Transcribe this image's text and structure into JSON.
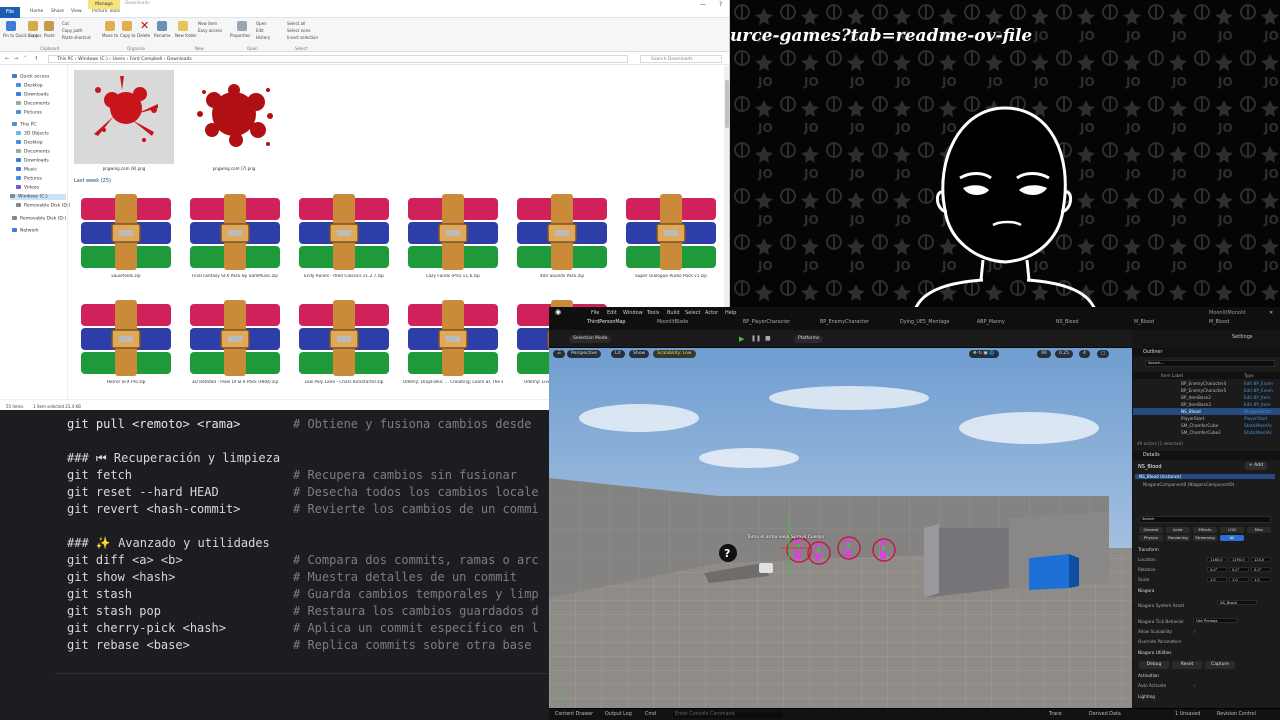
{
  "overlay": {
    "url_fragment": "urce-games?tab=readme-ov-file"
  },
  "explorer": {
    "tabs": [
      "File",
      "Home",
      "Share",
      "View",
      "Picture Tools"
    ],
    "manage_label": "Manage",
    "window_title": "Downloads",
    "ribbon": {
      "pin_label": "Pin to Quick access",
      "copy_label": "Copy",
      "paste_label": "Paste",
      "cut_label": "Cut",
      "copy_path_label": "Copy path",
      "paste_shortcut_label": "Paste shortcut",
      "move_to_label": "Move to",
      "copy_to_label": "Copy to",
      "delete_label": "Delete",
      "rename_label": "Rename",
      "new_folder_label": "New folder",
      "new_item_label": "New item",
      "easy_access_label": "Easy access",
      "properties_label": "Properties",
      "open_label": "Open",
      "edit_label": "Edit",
      "history_label": "History",
      "select_all_label": "Select all",
      "select_none_label": "Select none",
      "invert_selection_label": "Invert selection",
      "groups": [
        "Clipboard",
        "Organize",
        "New",
        "Open",
        "Select"
      ]
    },
    "address": [
      "This PC",
      "Windows (C:)",
      "Users",
      "Ford Campbell",
      "Downloads"
    ],
    "search_placeholder": "Search Downloads",
    "nav": [
      "Quick access",
      "Desktop",
      "Downloads",
      "Documents",
      "Pictures",
      "This PC",
      "3D Objects",
      "Desktop",
      "Documents",
      "Downloads",
      "Music",
      "Pictures",
      "Videos",
      "Windows (C:)",
      "Removable Disk (D:)",
      "Removable Disk (D:)",
      "Network"
    ],
    "images": [
      "pngwing.com (8).png",
      "pngwing.com (7).png"
    ],
    "group_label": "Last week (25)",
    "files_row1": [
      "Louiefolds.zip",
      "Final Fantasy SFX Pack By SamMusic.zip",
      "Ecdy Runes - Ifred Classics v1.2.7.zip",
      "Lazy Funds (Pro) v1.6.zip",
      "400 Sounds Pack.zip",
      "Super Dialogue Audio Pack v1.zip"
    ],
    "files_row2": [
      "Horror SFX Pro.zip",
      "3D Rotated - Pixel UI SFX Pack (HRB).zip",
      "Low Poly Lane - Chars Kickstarter.zip",
      "Udemy: DropFolks: ... Cheating; Learn as The Easiest_Way_2025...Downloadly.ir.rar",
      "Udemy: Live Tr..._Course_2025...zip",
      ""
    ],
    "status_items": "55 items",
    "status_selected": "1 item selected  25.4 KB"
  },
  "terminal": {
    "lines": [
      {
        "cmd": "git pull <remoto> <rama>",
        "comment": "# Obtiene y fusiona cambios desde"
      },
      {
        "head": "### ⏮ Recuperación y limpieza"
      },
      {
        "cmd": "git fetch",
        "comment": "# Recupera cambios sin fusionar"
      },
      {
        "cmd": "git reset --hard HEAD",
        "comment": "# Desecha todos los cambios locale"
      },
      {
        "cmd": "git revert <hash-commit>",
        "comment": "# Revierte los cambios de un commi"
      },
      {
        "head": "### ✨ Avanzado y utilidades"
      },
      {
        "cmd": "git diff <a> <b>",
        "comment": "# Compara dos commits, ramas o arc"
      },
      {
        "cmd": "git show <hash>",
        "comment": "# Muestra detalles de un commit"
      },
      {
        "cmd": "git stash",
        "comment": "# Guarda cambios temporales y limp"
      },
      {
        "cmd": "git stash pop",
        "comment": "# Restaura los cambios guardados d"
      },
      {
        "cmd": "git cherry-pick <hash>",
        "comment": "# Aplica un commit específico en l"
      },
      {
        "cmd": "git rebase <base>",
        "comment": "# Replica commits sobre otra base"
      }
    ]
  },
  "unreal": {
    "window_title": "MoonlitMonolit",
    "menu": [
      "File",
      "Edit",
      "Window",
      "Tools",
      "Build",
      "Select",
      "Actor",
      "Help"
    ],
    "tabs": [
      "ThirdPersonMap",
      "MoonlitBlade",
      "BP_PlayerCharacter",
      "BP_EnemyCharacter",
      "Dying_UE5_Montage",
      "ABP_Manny",
      "NS_Blood",
      "M_Blood",
      "M_Blood"
    ],
    "toolbar": {
      "mode": "Selection Mode",
      "platforms": "Platforms",
      "settings": "Settings"
    },
    "viewport": {
      "perspective": "Perspective",
      "lit": "Lit",
      "show": "Show",
      "scalability": "Scalability: Low",
      "fov": "90",
      "snap": "0.25",
      "cam": "4"
    },
    "outliner": {
      "title": "Outliner",
      "search_placeholder": "Search...",
      "col_label": "Item Label",
      "col_type": "Type",
      "rows": [
        {
          "name": "BP_EnemyCharacter4",
          "type": "Edit BP_Enem"
        },
        {
          "name": "BP_EnemyCharacter5",
          "type": "Edit BP_Enem"
        },
        {
          "name": "BP_ItemBase2",
          "type": "Edit BP_Item"
        },
        {
          "name": "BP_ItemBase3",
          "type": "Edit BP_Item"
        },
        {
          "name": "NS_Blood",
          "type": "NiagaraActor"
        },
        {
          "name": "PlayerStart",
          "type": "PlayerStart"
        },
        {
          "name": "SM_ChamferCube",
          "type": "StaticMeshAc"
        },
        {
          "name": "SM_ChamferCube2",
          "type": "StaticMeshAc"
        }
      ],
      "count": "49 actors (1 selected)"
    },
    "details": {
      "title": "Details",
      "actor": "NS_Blood",
      "add": "+ Add",
      "component_root": "NS_Blood (Instance)",
      "component_child": "NiagaraComponent0 (NiagaraComponent0)",
      "search_placeholder": "Search",
      "filters1": [
        "General",
        "Actor",
        "Effects",
        "LOD",
        "Misc"
      ],
      "filters2": [
        "Physics",
        "Rendering",
        "Streaming",
        "All"
      ],
      "transform_label": "Transform",
      "location_label": "Location",
      "rotation_label": "Rotation",
      "scale_label": "Scale",
      "location": [
        "1160.0",
        "1190.0",
        "120.0"
      ],
      "rotation": [
        "0.0°",
        "0.0°",
        "0.0°"
      ],
      "scale": [
        "1.0",
        "1.0",
        "1.0"
      ],
      "niagara_label": "Niagara",
      "system_asset_label": "Niagara System Asset",
      "system_asset_value": "NS_Blood",
      "tick_behavior_label": "Niagara Tick Behavior",
      "tick_behavior_value": "Use Prereqs",
      "allow_scalability_label": "Allow Scalability",
      "override_params_label": "Override Parameters",
      "utilities_label": "Niagara Utilities",
      "debug": "Debug",
      "reset": "Reset",
      "capture": "Capture",
      "activation_label": "Activation",
      "auto_activate_label": "Auto Activate",
      "lighting_label": "Lighting"
    },
    "bottom": {
      "content_drawer": "Content Drawer",
      "output_log": "Output Log",
      "cmd": "Cmd",
      "console_placeholder": "Enter Console Command",
      "trace": "Trace",
      "derived_data": "Derived Data",
      "unsaved": "1 Unsaved",
      "revision": "Revision Control"
    },
    "scene_label": "Toma el arma vieja Sprays Cuerpo"
  }
}
